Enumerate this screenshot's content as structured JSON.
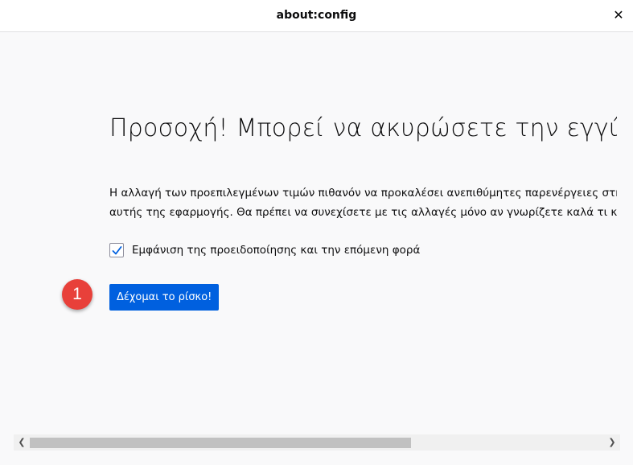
{
  "window": {
    "title": "about:config",
    "close_glyph": "✕"
  },
  "warning": {
    "headline": "Προσοχή! Μπορεί να ακυρώσετε την εγγύηση!",
    "body_line1": "Η αλλαγή των προεπιλεγμένων τιμών πιθανόν να προκαλέσει ανεπιθύμητες παρενέργειες στη σταθερότητα, την ασφάλεια και τις επιδόσεις",
    "body_line2": "αυτής της εφαρμογής. Θα πρέπει να συνεχίσετε με τις αλλαγές μόνο αν γνωρίζετε καλά τι κάνετε.",
    "checkbox_label": "Εμφάνιση της προειδοποίησης και την επόμενη φορά",
    "checkbox_checked": true,
    "accept_button": "Δέχομαι το ρίσκο!"
  },
  "annotation": {
    "step_number": "1",
    "color": "#e8403a"
  },
  "scrollbar": {
    "left_arrow": "❮",
    "right_arrow": "❯"
  },
  "colors": {
    "accent": "#0060df",
    "checkmark": "#0060df"
  }
}
